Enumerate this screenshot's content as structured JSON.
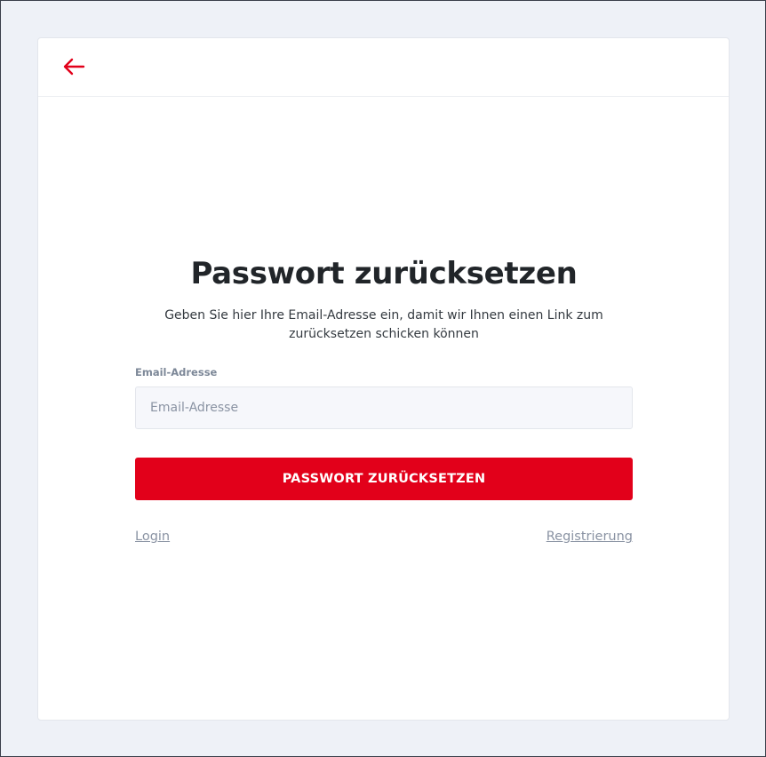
{
  "header": {
    "back_icon": "arrow-left-icon",
    "accent_color": "#e2001a"
  },
  "form": {
    "title": "Passwort zurücksetzen",
    "subtitle": "Geben Sie hier Ihre Email-Adresse ein, damit wir Ihnen einen Link zum zurücksetzen schicken können",
    "email_label": "Email-Adresse",
    "email_placeholder": "Email-Adresse",
    "email_value": "",
    "submit_label": "PASSWORT ZURÜCKSETZEN"
  },
  "links": {
    "login": "Login",
    "register": "Registrierung"
  },
  "colors": {
    "background": "#eef1f7",
    "button": "#e2001a",
    "muted_text": "#8a93a3"
  }
}
